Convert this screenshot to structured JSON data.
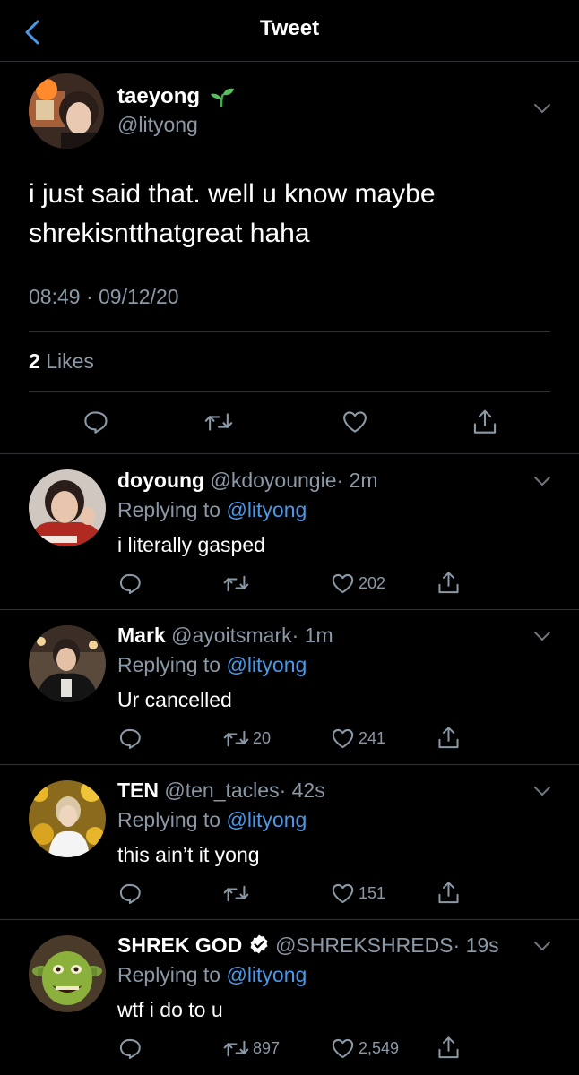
{
  "header": {
    "title": "Tweet"
  },
  "tweet": {
    "name": "taeyong",
    "name_emoji": "seedling-icon",
    "handle": "@lityong",
    "text": "i just said that. well u know maybe shrekisntthatgreat haha",
    "timestamp": "08:49 · 09/12/20",
    "likes_count": "2",
    "likes_label": "Likes"
  },
  "replies": [
    {
      "name": "doyoung",
      "handle": "@kdoyoungie",
      "time": "· 2m",
      "replying_label": "Replying to",
      "replying_handle": "@lityong",
      "text": "i literally gasped",
      "retweets": "",
      "likes": "202"
    },
    {
      "name": "Mark",
      "handle": "@ayoitsmark",
      "time": "· 1m",
      "replying_label": "Replying to",
      "replying_handle": "@lityong",
      "text": "Ur cancelled",
      "retweets": "20",
      "likes": "241"
    },
    {
      "name": "TEN",
      "handle": "@ten_tacles",
      "time": "· 42s",
      "replying_label": "Replying to",
      "replying_handle": "@lityong",
      "text": "this ain’t it yong",
      "retweets": "",
      "likes": "151"
    },
    {
      "name": "SHREK GOD",
      "verified": true,
      "handle": "@SHREKSHREDS",
      "time": "· 19s",
      "replying_label": "Replying to",
      "replying_handle": "@lityong",
      "text": "wtf i do to u",
      "retweets": "897",
      "likes": "2,549"
    }
  ],
  "colors": {
    "background": "#000000",
    "text": "#ffffff",
    "secondary": "#8b98a5",
    "accent": "#4a99e9",
    "divider": "#2f3336"
  }
}
